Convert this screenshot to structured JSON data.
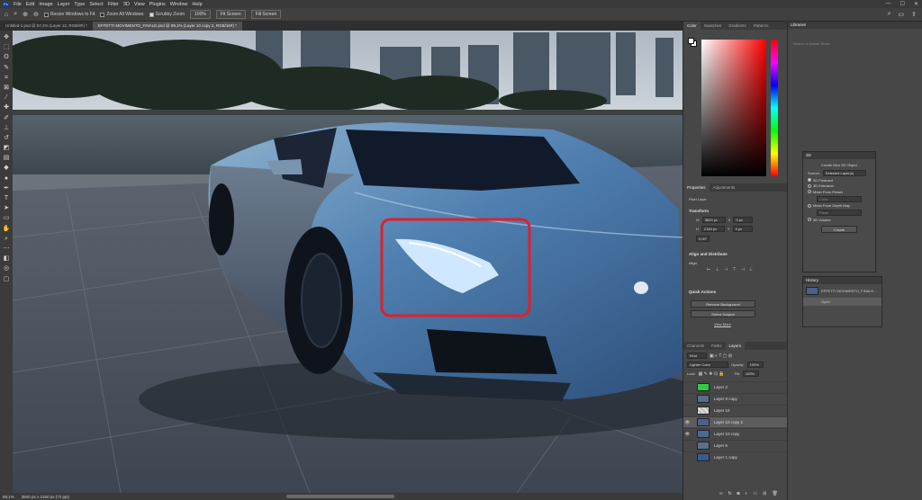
{
  "app": {
    "menu": [
      "File",
      "Edit",
      "Image",
      "Layer",
      "Type",
      "Select",
      "Filter",
      "3D",
      "View",
      "Plugins",
      "Window",
      "Help"
    ],
    "window_controls": [
      "—",
      "☐",
      "✕"
    ]
  },
  "options_bar": {
    "checks": [
      "Resize Windows to Fit",
      "Zoom All Windows",
      "Scrubby Zoom"
    ],
    "zoom_value": "100%",
    "fit_screen": "Fit Screen",
    "fill_screen": "Fill Screen"
  },
  "tabs": [
    {
      "label": "Untitled-1.psd @ 57,2% (Layer 12, RGB/8#) *",
      "active": false
    },
    {
      "label": "EFFETTI MOVIMENTO_FINALE.psd @ 89,1% (Layer 10 copy 2, RGB/16#) *",
      "active": true
    }
  ],
  "status": {
    "zoom": "89,1%",
    "doc_size": "3840 px x 2160 px (72 ppi)"
  },
  "color_panel": {
    "tabs": [
      "Color",
      "Swatches",
      "Gradients",
      "Patterns"
    ],
    "hue_color": "#ff0000"
  },
  "properties_panel": {
    "tabs": [
      "Properties",
      "Adjustments"
    ],
    "kind": "Pixel Layer",
    "transform_title": "Transform",
    "w_label": "W",
    "w_value": "3820 px",
    "h_label": "H",
    "h_value": "2160 px",
    "x_label": "X",
    "x_value": "0 px",
    "y_label": "Y",
    "y_value": "0 px",
    "angle": "0,00°",
    "align_title": "Align and Distribute",
    "align_sub": "Align:",
    "quick_title": "Quick Actions",
    "remove_bg": "Remove Background",
    "select_subject": "Select Subject",
    "view_more": "View More"
  },
  "layers_panel": {
    "tabs": [
      "Channels",
      "Paths",
      "Layers"
    ],
    "filter_kind": "Kind",
    "blend_mode": "Lighter Color",
    "opacity_label": "Opacity:",
    "opacity_value": "100%",
    "lock_label": "Lock:",
    "fill_label": "Fill:",
    "fill_value": "100%",
    "layers": [
      {
        "name": "Layer 2",
        "visible": false,
        "selected": false,
        "thumb": "#2ecc40"
      },
      {
        "name": "Layer 9 copy",
        "visible": false,
        "selected": false,
        "thumb": "#5a6c8a"
      },
      {
        "name": "Layer 10",
        "visible": false,
        "selected": false,
        "thumb": "#d8d8d8"
      },
      {
        "name": "Layer 10 copy 2",
        "visible": true,
        "selected": true,
        "thumb": "#4a6288"
      },
      {
        "name": "Layer 10 copy",
        "visible": true,
        "selected": false,
        "thumb": "#4f6a90"
      },
      {
        "name": "Layer 6",
        "visible": false,
        "selected": false,
        "thumb": "#5a7090"
      },
      {
        "name": "Layer 1 copy",
        "visible": false,
        "selected": false,
        "thumb": "#3a5a8a"
      }
    ]
  },
  "libraries_panel": {
    "title": "Libraries",
    "search_placeholder": "Search in Adobe Stock"
  },
  "panel_3d": {
    "title": "3D",
    "create_new": "Create New 3D Object",
    "source_label": "Source:",
    "source_value": "Selected Layer(s)",
    "options": [
      "3D Postcard",
      "3D Extrusion",
      "Mesh From Preset",
      "Mesh From Depth Map",
      "3D Volume"
    ],
    "selected_option": "3D Postcard",
    "preset_value": "Cone",
    "depth_value": "Plane",
    "create_button": "Create"
  },
  "history_panel": {
    "title": "History",
    "snapshot": "EFFETTI MOVIMENTO_FINALE...",
    "state": "Open"
  },
  "annotation": {
    "highlight_color": "#e0202a"
  }
}
